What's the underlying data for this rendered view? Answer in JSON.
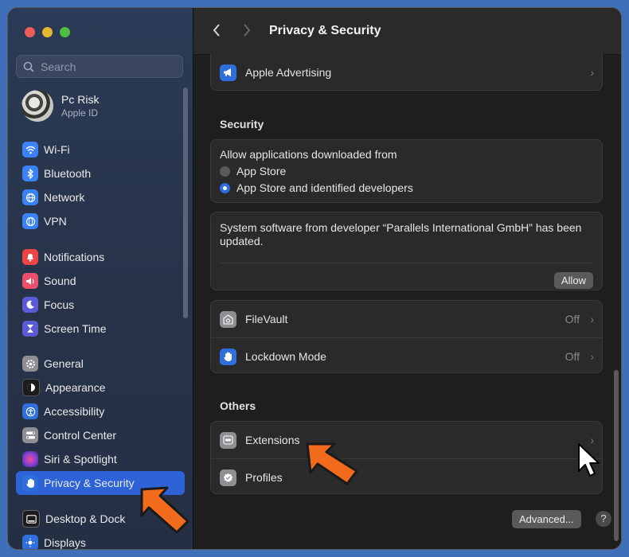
{
  "window": {
    "title": "Privacy & Security"
  },
  "sidebar": {
    "search_placeholder": "Search",
    "account": {
      "name": "Pc Risk",
      "subtitle": "Apple ID"
    },
    "groups": [
      [
        {
          "label": "Wi-Fi",
          "icon": "wifi-icon",
          "color": "#3b82f6"
        },
        {
          "label": "Bluetooth",
          "icon": "bluetooth-icon",
          "color": "#3b82f6"
        },
        {
          "label": "Network",
          "icon": "globe-icon",
          "color": "#3b82f6"
        },
        {
          "label": "VPN",
          "icon": "vpn-globe-icon",
          "color": "#3b82f6"
        }
      ],
      [
        {
          "label": "Notifications",
          "icon": "bell-icon",
          "color": "#ef4444"
        },
        {
          "label": "Sound",
          "icon": "speaker-icon",
          "color": "#ec4f6b"
        },
        {
          "label": "Focus",
          "icon": "moon-icon",
          "color": "#5b5bd6"
        },
        {
          "label": "Screen Time",
          "icon": "hourglass-icon",
          "color": "#5b5bd6"
        }
      ],
      [
        {
          "label": "General",
          "icon": "gear-icon",
          "color": "#8e8e93"
        },
        {
          "label": "Appearance",
          "icon": "appearance-icon",
          "color": "#1c1c1e"
        },
        {
          "label": "Accessibility",
          "icon": "accessibility-icon",
          "color": "#2f6fdc"
        },
        {
          "label": "Control Center",
          "icon": "toggles-icon",
          "color": "#8e8e93"
        },
        {
          "label": "Siri & Spotlight",
          "icon": "siri-icon",
          "color": "#7b3fd1"
        },
        {
          "label": "Privacy & Security",
          "icon": "hand-icon",
          "color": "#2f6fdc",
          "active": true
        }
      ],
      [
        {
          "label": "Desktop & Dock",
          "icon": "dock-icon",
          "color": "#1c1c1e"
        },
        {
          "label": "Displays",
          "icon": "sun-icon",
          "color": "#2f6fdc"
        }
      ]
    ]
  },
  "main": {
    "title": "Privacy & Security",
    "apple_advertising": "Apple Advertising",
    "security_title": "Security",
    "allow_from_label": "Allow applications downloaded from",
    "radio_options": [
      {
        "label": "App Store",
        "selected": false
      },
      {
        "label": "App Store and identified developers",
        "selected": true
      }
    ],
    "system_software_message": "System software from developer “Parallels International GmbH” has been updated.",
    "allow_button": "Allow",
    "filevault": {
      "label": "FileVault",
      "value": "Off"
    },
    "lockdown": {
      "label": "Lockdown Mode",
      "value": "Off"
    },
    "others_title": "Others",
    "extensions": "Extensions",
    "profiles": "Profiles",
    "advanced_button": "Advanced...",
    "help_button": "?"
  },
  "colors": {
    "accent": "#2d63d6",
    "annotation_arrow": "#f26a1b"
  }
}
